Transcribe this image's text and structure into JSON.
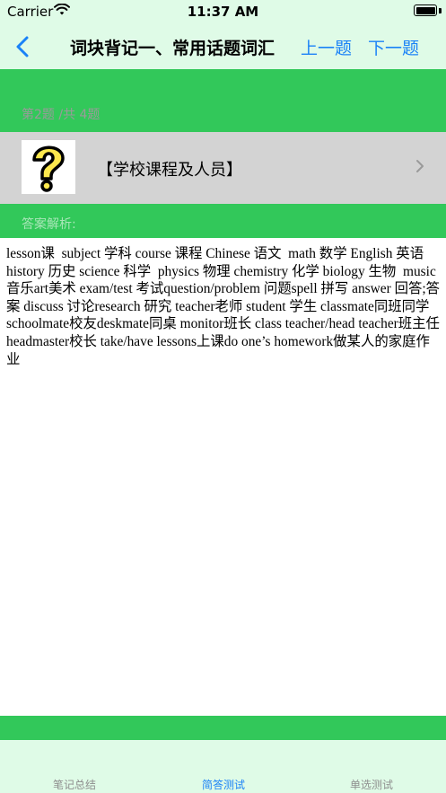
{
  "status": {
    "carrier": "Carrier",
    "time": "11:37 AM"
  },
  "nav": {
    "title": "词块背记一、常用话题词汇",
    "prev_label": "上一题",
    "next_label": "下一题"
  },
  "question": {
    "counter": "第2题 /共 4题",
    "text": "【学校课程及人员】"
  },
  "answer": {
    "label": "答案解析:",
    "body": "lesson课  subject 学科 course 课程 Chinese 语文  math 数学 English 英语 history 历史 science 科学  physics 物理 chemistry 化学 biology 生物  music 音乐art美术 exam/test 考试question/problem 问题spell 拼写 answer 回答;答案 discuss 讨论research 研究 teacher老师 student 学生 classmate同班同学 schoolmate校友deskmate同桌 monitor班长 class teacher/head teacher班主任\nheadmaster校长 take/have lessons上课do one’s homework做某人的家庭作业"
  },
  "tabs": [
    {
      "label": "笔记总结",
      "active": false
    },
    {
      "label": "简答测试",
      "active": true
    },
    {
      "label": "单选测试",
      "active": false
    }
  ],
  "colors": {
    "accent": "#1a82f7",
    "green": "#32c85a",
    "bar_bg": "#dffbe7",
    "question_bg": "#d3d3d3"
  }
}
